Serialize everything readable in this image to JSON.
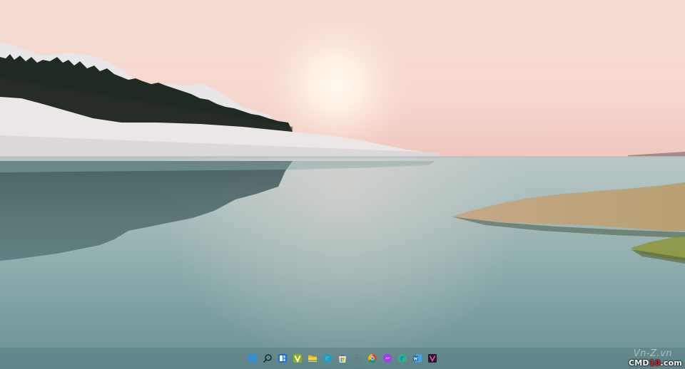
{
  "wallpaper": {
    "sky_colors": [
      "#f3dcd0",
      "#f6d6cf",
      "#f1c9c1"
    ],
    "water_colors": [
      "#9fb8b7",
      "#7fa3a4",
      "#6a9193"
    ],
    "hill_color": "#e9e6e6"
  },
  "taskbar": {
    "icons": [
      {
        "name": "start-icon",
        "label": "Start"
      },
      {
        "name": "search-icon",
        "label": "Search"
      },
      {
        "name": "widgets-icon",
        "label": "Widgets"
      },
      {
        "name": "v-app-icon",
        "label": "V"
      },
      {
        "name": "file-explorer-icon",
        "label": "File Explorer"
      },
      {
        "name": "edge-icon",
        "label": "Microsoft Edge"
      },
      {
        "name": "store-icon",
        "label": "Microsoft Store"
      },
      {
        "name": "settings-icon",
        "label": "Settings"
      },
      {
        "name": "chrome-icon",
        "label": "Google Chrome"
      },
      {
        "name": "messenger-icon",
        "label": "Messenger"
      },
      {
        "name": "edge-beta-icon",
        "label": "Edge"
      },
      {
        "name": "word-icon",
        "label": "Word"
      },
      {
        "name": "vegas-icon",
        "label": "Vegas"
      }
    ]
  },
  "watermark": {
    "site": "Vn-Z.vn",
    "brand_prefix": "CMD",
    "brand_number": "10",
    "brand_suffix": ".com"
  }
}
